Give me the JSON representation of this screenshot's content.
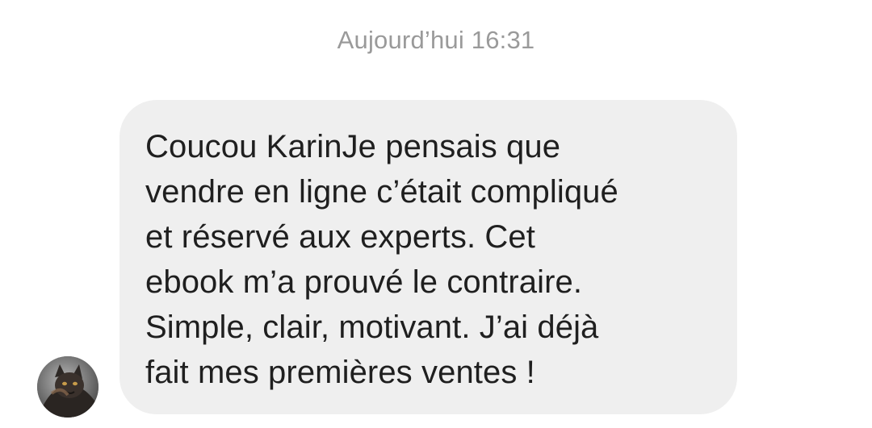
{
  "conversation": {
    "timestamp": "Aujourd’hui 16:31",
    "message": {
      "text": "Coucou KarinJe pensais que\nvendre en ligne c’était compliqué\net réservé aux experts. Cet\nebook m’a prouvé le contraire.\nSimple, clair, motivant. J’ai déjà\nfait mes premières ventes !",
      "sender_avatar_icon": "contact-avatar"
    },
    "colors": {
      "bubble_background": "#efefef",
      "message_text": "#1f1f1f",
      "timestamp_text": "#9a9a9a"
    }
  }
}
